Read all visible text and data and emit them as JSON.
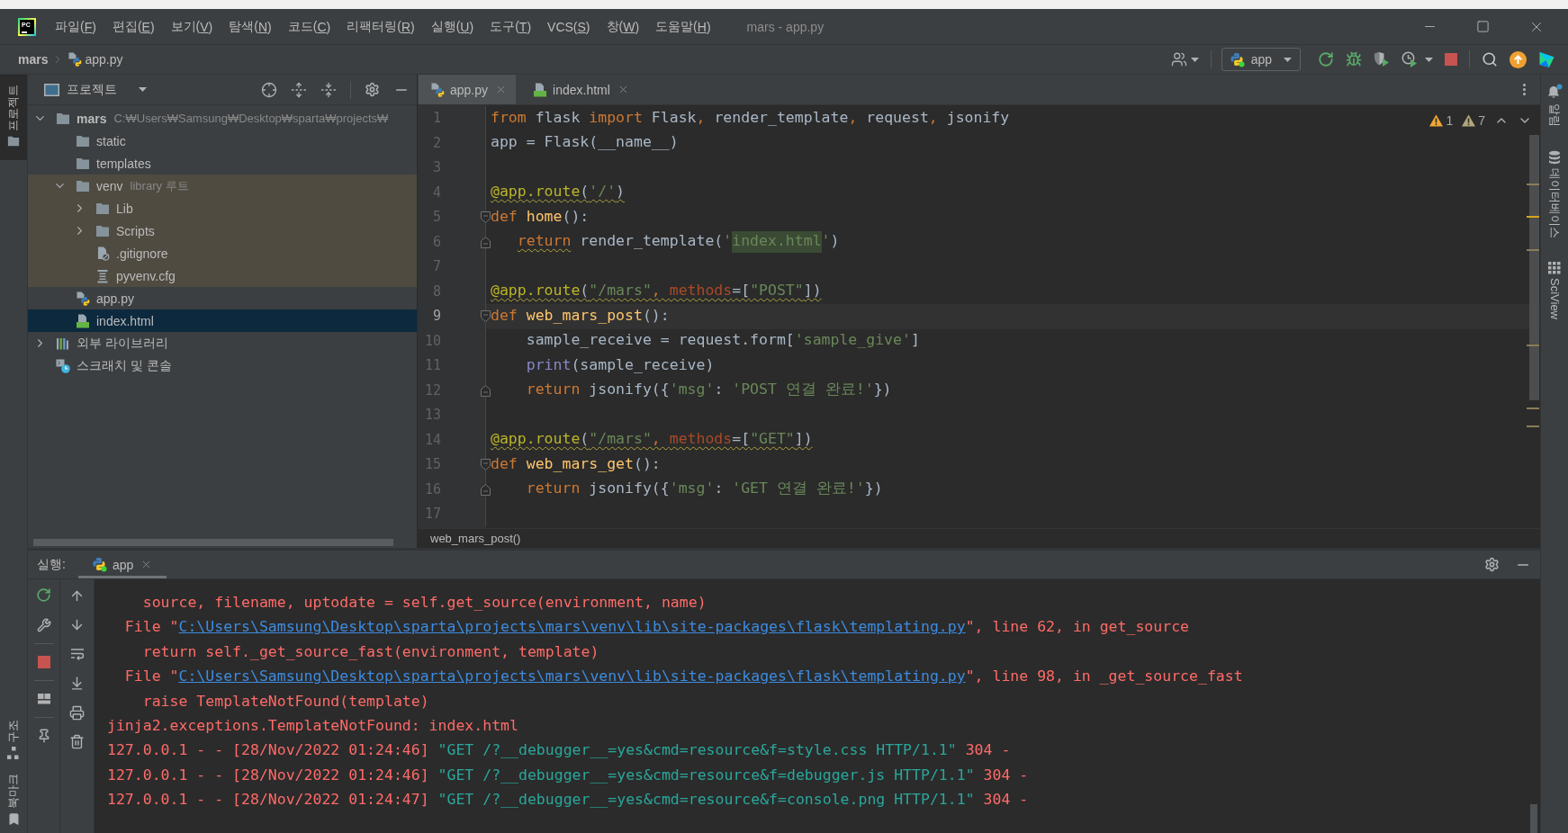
{
  "title_bar": {
    "logo": "PC",
    "menu": [
      {
        "label": "파일(F)"
      },
      {
        "label": "편집(E)"
      },
      {
        "label": "보기(V)"
      },
      {
        "label": "탐색(N)"
      },
      {
        "label": "코드(C)"
      },
      {
        "label": "리팩터링(R)"
      },
      {
        "label": "실행(U)"
      },
      {
        "label": "도구(T)"
      },
      {
        "label": "VCS(S)"
      },
      {
        "label": "창(W)"
      },
      {
        "label": "도움말(H)"
      }
    ],
    "title": "mars - app.py"
  },
  "navigation_bar": {
    "breadcrumbs": [
      {
        "label": "mars",
        "kind": "project"
      },
      {
        "label": "app.py",
        "kind": "python"
      }
    ],
    "run_config": {
      "label": "app",
      "running": true
    }
  },
  "left_stripe": {
    "top": [
      {
        "label": "프로젝트",
        "kind": "project",
        "selected": true
      }
    ],
    "bottom": [
      {
        "label": "구조",
        "kind": "structure",
        "selected": false
      },
      {
        "label": "북마크",
        "kind": "bookmarks",
        "selected": false
      }
    ]
  },
  "project_panel": {
    "title": "프로젝트",
    "tree": [
      {
        "label": "mars",
        "kind": "project",
        "hint": "C:₩Users₩Samsung₩Desktop₩sparta₩projects₩",
        "expanded": true,
        "selected": false,
        "children": [
          {
            "label": "static",
            "kind": "folder",
            "selected": false
          },
          {
            "label": "templates",
            "kind": "folder",
            "selected": false
          },
          {
            "label": "venv",
            "kind": "folder",
            "hint": "library 루트",
            "library_root": true,
            "expanded": true,
            "selected": false,
            "children": [
              {
                "label": "Lib",
                "kind": "folder",
                "expanded": false,
                "selected": false
              },
              {
                "label": "Scripts",
                "kind": "folder",
                "expanded": false,
                "selected": false
              },
              {
                "label": ".gitignore",
                "kind": "gitignore",
                "selected": false
              },
              {
                "label": "pyvenv.cfg",
                "kind": "config",
                "selected": false
              }
            ]
          },
          {
            "label": "app.py",
            "kind": "python",
            "selected": false
          },
          {
            "label": "index.html",
            "kind": "html",
            "selected": true
          }
        ]
      },
      {
        "label": "외부 라이브러리",
        "kind": "libraries",
        "expanded": false,
        "selected": false
      },
      {
        "label": "스크래치 및 콘솔",
        "kind": "scratches",
        "selected": false
      }
    ]
  },
  "editor": {
    "tabs": [
      {
        "label": "app.py",
        "kind": "python",
        "selected": true
      },
      {
        "label": "index.html",
        "kind": "html",
        "selected": false
      }
    ],
    "inspections": [
      {
        "kind": "warning",
        "count": "1"
      },
      {
        "kind": "weak_warning",
        "count": "7"
      }
    ],
    "lines": [
      {
        "number": "1",
        "current": false,
        "tokens": [
          {
            "text": "from",
            "kind": "keyword"
          },
          {
            "text": " flask ",
            "kind": "plain"
          },
          {
            "text": "import",
            "kind": "keyword"
          },
          {
            "text": " Flask",
            "kind": "plain"
          },
          {
            "text": ",",
            "kind": "punct"
          },
          {
            "text": " render_template",
            "kind": "plain"
          },
          {
            "text": ",",
            "kind": "punct"
          },
          {
            "text": " request",
            "kind": "plain"
          },
          {
            "text": ",",
            "kind": "punct"
          },
          {
            "text": " jsonify",
            "kind": "plain"
          }
        ]
      },
      {
        "number": "2",
        "current": false,
        "tokens": [
          {
            "text": "app = Flask(__name__)",
            "kind": "plain"
          }
        ]
      },
      {
        "number": "3",
        "current": false
      },
      {
        "number": "4",
        "current": false,
        "tokens": [
          {
            "text": "@app.route",
            "kind": "decorator",
            "warning": true
          },
          {
            "text": "(",
            "kind": "plain",
            "warning": true
          },
          {
            "text": "'/'",
            "kind": "string",
            "warning": true
          },
          {
            "text": ")",
            "kind": "plain",
            "warning": true
          }
        ]
      },
      {
        "number": "5",
        "current": false,
        "fold_start": true,
        "tokens": [
          {
            "text": "def ",
            "kind": "keyword"
          },
          {
            "text": "home",
            "kind": "function"
          },
          {
            "text": "():",
            "kind": "plain"
          }
        ]
      },
      {
        "number": "6",
        "current": false,
        "fold_end": true,
        "tokens": [
          {
            "text": "   return",
            "kind": "keyword",
            "warning": true
          },
          {
            "text": " render_template(",
            "kind": "plain"
          },
          {
            "text": "'",
            "kind": "string"
          },
          {
            "text": "index.html",
            "kind": "string",
            "highlight": true
          },
          {
            "text": "'",
            "kind": "string"
          },
          {
            "text": ")",
            "kind": "plain"
          }
        ]
      },
      {
        "number": "7",
        "current": false
      },
      {
        "number": "8",
        "current": false,
        "tokens": [
          {
            "text": "@app.route",
            "kind": "decorator",
            "warning": true
          },
          {
            "text": "(",
            "kind": "plain",
            "warning": true
          },
          {
            "text": "\"/mars\"",
            "kind": "string",
            "warning": true
          },
          {
            "text": ", ",
            "kind": "punct",
            "warning": true
          },
          {
            "text": "methods",
            "kind": "param",
            "warning": true
          },
          {
            "text": "=[",
            "kind": "plain",
            "warning": true
          },
          {
            "text": "\"POST\"",
            "kind": "string",
            "warning": true
          },
          {
            "text": "])",
            "kind": "plain",
            "warning": true
          }
        ]
      },
      {
        "number": "9",
        "current": true,
        "fold_start": true,
        "tokens": [
          {
            "text": "def ",
            "kind": "keyword"
          },
          {
            "text": "web_mars_post",
            "kind": "function"
          },
          {
            "text": "():",
            "kind": "plain"
          }
        ]
      },
      {
        "number": "10",
        "current": false,
        "tokens": [
          {
            "text": "    sample_receive = request.form[",
            "kind": "plain"
          },
          {
            "text": "'sample_give'",
            "kind": "string"
          },
          {
            "text": "]",
            "kind": "plain"
          }
        ]
      },
      {
        "number": "11",
        "current": false,
        "tokens": [
          {
            "text": "    print",
            "kind": "builtin"
          },
          {
            "text": "(sample_receive)",
            "kind": "plain"
          }
        ]
      },
      {
        "number": "12",
        "current": false,
        "fold_end": true,
        "tokens": [
          {
            "text": "    return",
            "kind": "keyword"
          },
          {
            "text": " jsonify({",
            "kind": "plain"
          },
          {
            "text": "'msg'",
            "kind": "string"
          },
          {
            "text": ": ",
            "kind": "plain"
          },
          {
            "text": "'POST 연결 완료!'",
            "kind": "string"
          },
          {
            "text": "})",
            "kind": "plain"
          }
        ]
      },
      {
        "number": "13",
        "current": false
      },
      {
        "number": "14",
        "current": false,
        "tokens": [
          {
            "text": "@app.route",
            "kind": "decorator",
            "warning": true
          },
          {
            "text": "(",
            "kind": "plain",
            "warning": true
          },
          {
            "text": "\"/mars\"",
            "kind": "string",
            "warning": true
          },
          {
            "text": ", ",
            "kind": "punct",
            "warning": true
          },
          {
            "text": "methods",
            "kind": "param",
            "warning": true
          },
          {
            "text": "=[",
            "kind": "plain",
            "warning": true
          },
          {
            "text": "\"GET\"",
            "kind": "string",
            "warning": true
          },
          {
            "text": "])",
            "kind": "plain",
            "warning": true
          }
        ]
      },
      {
        "number": "15",
        "current": false,
        "fold_start": true,
        "tokens": [
          {
            "text": "def ",
            "kind": "keyword"
          },
          {
            "text": "web_mars_get",
            "kind": "function"
          },
          {
            "text": "():",
            "kind": "plain"
          }
        ]
      },
      {
        "number": "16",
        "current": false,
        "fold_end": true,
        "tokens": [
          {
            "text": "    return",
            "kind": "keyword"
          },
          {
            "text": " jsonify({",
            "kind": "plain"
          },
          {
            "text": "'msg'",
            "kind": "string"
          },
          {
            "text": ": ",
            "kind": "plain"
          },
          {
            "text": "'GET 연결 완료!'",
            "kind": "string"
          },
          {
            "text": "})",
            "kind": "plain"
          }
        ]
      },
      {
        "number": "17",
        "current": false
      }
    ],
    "breadcrumb": "web_mars_post()"
  },
  "run_panel": {
    "label": "실행:",
    "tabs": [
      {
        "label": "app",
        "running": true,
        "selected": true
      }
    ],
    "console": [
      {
        "segments": [
          {
            "text": "    source, filename, uptodate = self.get_source(environment, name)",
            "kind": "error"
          }
        ]
      },
      {
        "segments": [
          {
            "text": "  File \"",
            "kind": "error"
          },
          {
            "text": "C:\\Users\\Samsung\\Desktop\\sparta\\projects\\mars\\venv\\lib\\site-packages\\flask\\templating.py",
            "kind": "link"
          },
          {
            "text": "\", line 62, in get_source",
            "kind": "error"
          }
        ]
      },
      {
        "segments": [
          {
            "text": "    return self._get_source_fast(environment, template)",
            "kind": "error"
          }
        ]
      },
      {
        "segments": [
          {
            "text": "  File \"",
            "kind": "error"
          },
          {
            "text": "C:\\Users\\Samsung\\Desktop\\sparta\\projects\\mars\\venv\\lib\\site-packages\\flask\\templating.py",
            "kind": "link"
          },
          {
            "text": "\", line 98, in _get_source_fast",
            "kind": "error"
          }
        ]
      },
      {
        "segments": [
          {
            "text": "    raise TemplateNotFound(template)",
            "kind": "error"
          }
        ]
      },
      {
        "segments": [
          {
            "text": "jinja2.exceptions.TemplateNotFound: index.html",
            "kind": "error"
          }
        ]
      },
      {
        "segments": [
          {
            "text": "127.0.0.1 - - [28/Nov/2022 01:24:46] ",
            "kind": "error"
          },
          {
            "text": "\"GET /?__debugger__=yes&cmd=resource&f=style.css HTTP/1.1\"",
            "kind": "request"
          },
          {
            "text": " 304 -",
            "kind": "error"
          }
        ]
      },
      {
        "segments": [
          {
            "text": "127.0.0.1 - - [28/Nov/2022 01:24:46] ",
            "kind": "error"
          },
          {
            "text": "\"GET /?__debugger__=yes&cmd=resource&f=debugger.js HTTP/1.1\"",
            "kind": "request"
          },
          {
            "text": " 304 -",
            "kind": "error"
          }
        ]
      },
      {
        "segments": [
          {
            "text": "127.0.0.1 - - [28/Nov/2022 01:24:47] ",
            "kind": "error"
          },
          {
            "text": "\"GET /?__debugger__=yes&cmd=resource&f=console.png HTTP/1.1\"",
            "kind": "request"
          },
          {
            "text": " 304 -",
            "kind": "error"
          }
        ]
      }
    ]
  },
  "right_stripe": [
    {
      "label": "알림",
      "kind": "notifications",
      "unread": true,
      "selected": false
    },
    {
      "label": "데이터베이스",
      "kind": "database",
      "selected": false
    },
    {
      "label": "SciView",
      "kind": "sciview",
      "selected": false
    }
  ]
}
